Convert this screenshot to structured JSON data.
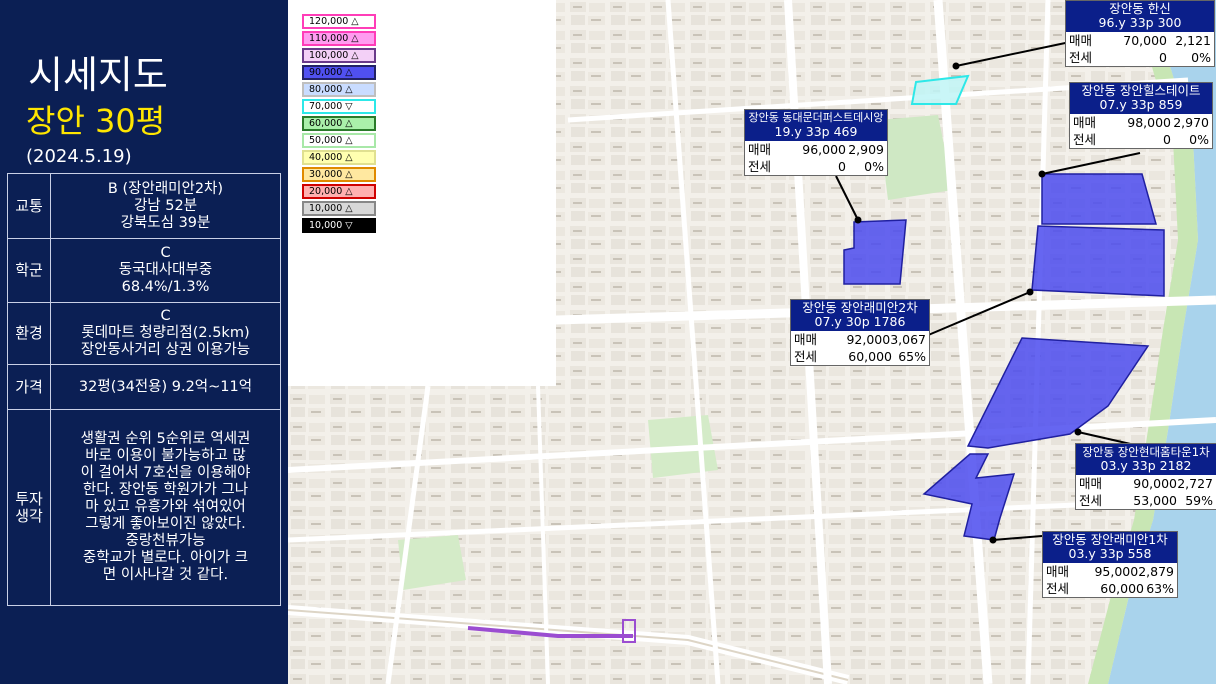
{
  "left_panel": {
    "title": "시세지도",
    "subtitle": "장안 30평",
    "date": "(2024.5.19)",
    "rows": [
      {
        "key": "교통",
        "lines": [
          "B (장안래미안2차)",
          "강남 52분",
          "강북도심 39분"
        ]
      },
      {
        "key": "학군",
        "lines": [
          "C",
          "동국대사대부중",
          "68.4%/1.3%"
        ]
      },
      {
        "key": "환경",
        "lines": [
          "C",
          "롯데마트 청량리점(2.5km)",
          "장안동사거리 상권 이용가능"
        ]
      },
      {
        "key": "가격",
        "lines": [
          "32평(34전용) 9.2억~11억"
        ]
      },
      {
        "key": "투자 생각",
        "lines": [
          "생활권 순위 5순위로 역세권",
          "바로 이용이 불가능하고 많",
          "이 걸어서 7호선을 이용해야",
          "한다. 장안동 학원가가 그나",
          "마 있고 유흥가와 섞여있어",
          "그렇게 좋아보이진 않았다.",
          "중랑천뷰가능",
          "중학교가 별로다. 아이가 크",
          "면 이사나갈 것 같다."
        ]
      }
    ]
  },
  "legend": [
    {
      "label": "120,000 △",
      "bg": "#ffffff",
      "border": "#ff3db8"
    },
    {
      "label": "110,000 △",
      "bg": "#ff9cf0",
      "border": "#ff3db8"
    },
    {
      "label": "100,000 △",
      "bg": "#f3d0f7",
      "border": "#6a3b8a"
    },
    {
      "label": "90,000 △",
      "bg": "#5050f0",
      "border": "#222266"
    },
    {
      "label": "80,000 △",
      "bg": "#c9dcff",
      "border": "#bfbfbf"
    },
    {
      "label": "70,000 ▽",
      "bg": "#ffffff",
      "border": "#2de8e8"
    },
    {
      "label": "60,000 △",
      "bg": "#aaf0aa",
      "border": "#2a7a2a"
    },
    {
      "label": "50,000 △",
      "bg": "#ffffff",
      "border": "#a8e8a8"
    },
    {
      "label": "40,000 △",
      "bg": "#ffffb0",
      "border": "#e0e090"
    },
    {
      "label": "30,000 △",
      "bg": "#ffe8a0",
      "border": "#e08a00"
    },
    {
      "label": "20,000 △",
      "bg": "#ffb0b0",
      "border": "#d00000"
    },
    {
      "label": "10,000 △",
      "bg": "#d8d8d8",
      "border": "#888888"
    },
    {
      "label": "10,000 ▽",
      "bg": "#000000",
      "border": "#000000",
      "text": "#ffffff"
    }
  ],
  "labels": [
    {
      "id": "hansin",
      "name": "장안동 한신",
      "info": "96.y  33p  300",
      "sale": [
        "매매",
        "70,000",
        "2,121"
      ],
      "jeonse": [
        "전세",
        "0",
        "0%"
      ]
    },
    {
      "id": "hills",
      "name": "장안동 장안힐스테이트",
      "info": "07.y  33p  859",
      "sale": [
        "매매",
        "98,000",
        "2,970"
      ],
      "jeonse": [
        "전세",
        "0",
        "0%"
      ]
    },
    {
      "id": "dongdaemun",
      "name": "장안동 동대문더퍼스트데시앙",
      "info": "19.y  33p  469",
      "sale": [
        "매매",
        "96,000",
        "2,909"
      ],
      "jeonse": [
        "전세",
        "0",
        "0%"
      ]
    },
    {
      "id": "raemian2",
      "name": "장안동 장안래미안2차",
      "info": "07.y  30p  1786",
      "sale": [
        "매매",
        "92,000",
        "3,067"
      ],
      "jeonse": [
        "전세",
        "60,000",
        "65%"
      ]
    },
    {
      "id": "hyundai",
      "name": "장안동 장안현대홈타운1차",
      "info": "03.y  33p  2182",
      "sale": [
        "매매",
        "90,000",
        "2,727"
      ],
      "jeonse": [
        "전세",
        "53,000",
        "59%"
      ]
    },
    {
      "id": "raemian1",
      "name": "장안동 장안래미안1차",
      "info": "03.y  33p  558",
      "sale": [
        "매매",
        "95,000",
        "2,879"
      ],
      "jeonse": [
        "전세",
        "60,000",
        "63%"
      ]
    }
  ],
  "colors": {
    "panel_bg": "#0b1f54",
    "title_yellow": "#ffe600",
    "polygon_fill": "#4b4bef",
    "polygon_stroke": "#2020a0",
    "label_header": "#0b1f8a"
  }
}
